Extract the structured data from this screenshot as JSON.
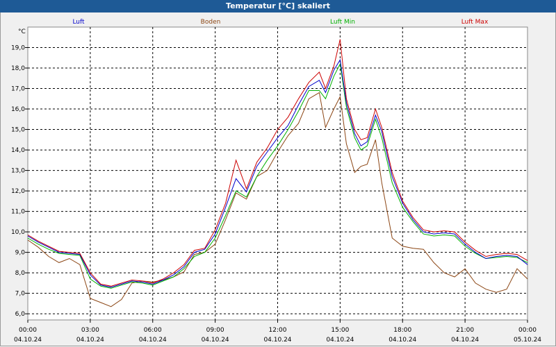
{
  "window": {
    "title": "Temperatur [°C] skaliert",
    "title_bar_color": "#1e5a96",
    "background": "#f0f0f0"
  },
  "chart_data": {
    "type": "line",
    "ylabel": "°C",
    "ylim": [
      5.7,
      20.0
    ],
    "grid": true,
    "legend_position": "top",
    "y_ticks": [
      "6,0",
      "7,0",
      "8,0",
      "9,0",
      "10,0",
      "11,0",
      "12,0",
      "13,0",
      "14,0",
      "15,0",
      "16,0",
      "17,0",
      "18,0",
      "19,0"
    ],
    "x_ticks": [
      {
        "time": "00:00",
        "date": "04.10.24"
      },
      {
        "time": "03:00",
        "date": "04.10.24"
      },
      {
        "time": "06:00",
        "date": "04.10.24"
      },
      {
        "time": "09:00",
        "date": "04.10.24"
      },
      {
        "time": "12:00",
        "date": "04.10.24"
      },
      {
        "time": "15:00",
        "date": "04.10.24"
      },
      {
        "time": "18:00",
        "date": "04.10.24"
      },
      {
        "time": "21:00",
        "date": "04.10.24"
      },
      {
        "time": "00:00",
        "date": "05.10.24"
      }
    ],
    "x_hours": [
      0,
      0.5,
      1,
      1.5,
      2,
      2.5,
      3,
      3.5,
      4,
      4.5,
      5,
      5.5,
      6,
      6.5,
      7,
      7.5,
      8,
      8.5,
      9,
      9.5,
      10,
      10.5,
      11,
      11.5,
      12,
      12.5,
      13,
      13.5,
      14,
      14.3,
      14.7,
      15,
      15.3,
      15.7,
      16,
      16.3,
      16.7,
      17,
      17.5,
      18,
      18.5,
      19,
      19.5,
      20,
      20.5,
      21,
      21.5,
      22,
      22.5,
      23,
      23.5,
      24
    ],
    "series": [
      {
        "name": "Luft",
        "color": "#0000cc",
        "values": [
          9.8,
          9.5,
          9.25,
          9.0,
          8.95,
          8.9,
          7.9,
          7.4,
          7.3,
          7.45,
          7.6,
          7.55,
          7.45,
          7.65,
          7.9,
          8.3,
          9.0,
          9.15,
          9.9,
          11.2,
          12.6,
          11.95,
          13.2,
          13.9,
          14.6,
          15.2,
          16.2,
          17.1,
          17.4,
          16.8,
          17.9,
          18.4,
          16.3,
          14.8,
          14.2,
          14.4,
          15.7,
          14.9,
          12.7,
          11.4,
          10.6,
          10.0,
          9.9,
          9.95,
          9.9,
          9.4,
          9.0,
          8.7,
          8.8,
          8.85,
          8.8,
          8.4
        ]
      },
      {
        "name": "Boden",
        "color": "#8b4513",
        "values": [
          9.6,
          9.25,
          8.8,
          8.5,
          8.7,
          8.4,
          6.75,
          6.55,
          6.35,
          6.7,
          7.5,
          7.6,
          7.55,
          7.65,
          7.8,
          8.05,
          8.9,
          9.0,
          9.4,
          10.6,
          11.9,
          11.6,
          12.7,
          13.0,
          13.9,
          14.7,
          15.3,
          16.5,
          16.8,
          15.1,
          16.0,
          16.6,
          14.3,
          12.9,
          13.2,
          13.3,
          14.5,
          12.4,
          9.7,
          9.3,
          9.2,
          9.15,
          8.5,
          8.0,
          7.8,
          8.2,
          7.5,
          7.2,
          7.05,
          7.2,
          8.2,
          7.7
        ]
      },
      {
        "name": "Luft Min",
        "color": "#00b000",
        "values": [
          9.7,
          9.4,
          9.15,
          8.95,
          8.9,
          8.85,
          7.7,
          7.35,
          7.25,
          7.4,
          7.55,
          7.5,
          7.4,
          7.6,
          7.8,
          8.2,
          8.8,
          9.0,
          9.7,
          10.8,
          12.0,
          11.7,
          12.7,
          13.5,
          14.2,
          15.0,
          15.9,
          16.9,
          16.9,
          16.5,
          17.6,
          18.2,
          16.1,
          14.6,
          14.0,
          14.2,
          15.5,
          14.6,
          12.4,
          11.2,
          10.5,
          9.9,
          9.8,
          9.85,
          9.8,
          9.3,
          8.95,
          8.7,
          8.75,
          8.8,
          8.75,
          8.5
        ]
      },
      {
        "name": "Luft Max",
        "color": "#cc0000",
        "values": [
          9.85,
          9.55,
          9.3,
          9.05,
          9.0,
          8.95,
          8.0,
          7.45,
          7.35,
          7.5,
          7.65,
          7.6,
          7.5,
          7.7,
          8.0,
          8.4,
          9.1,
          9.2,
          10.1,
          11.4,
          13.5,
          12.1,
          13.4,
          14.1,
          15.0,
          15.6,
          16.5,
          17.3,
          17.8,
          17.0,
          18.1,
          19.4,
          16.5,
          15.0,
          14.5,
          14.6,
          16.0,
          15.1,
          12.9,
          11.5,
          10.7,
          10.1,
          10.0,
          10.05,
          10.0,
          9.5,
          9.1,
          8.8,
          8.9,
          8.95,
          8.9,
          8.6
        ]
      }
    ]
  }
}
